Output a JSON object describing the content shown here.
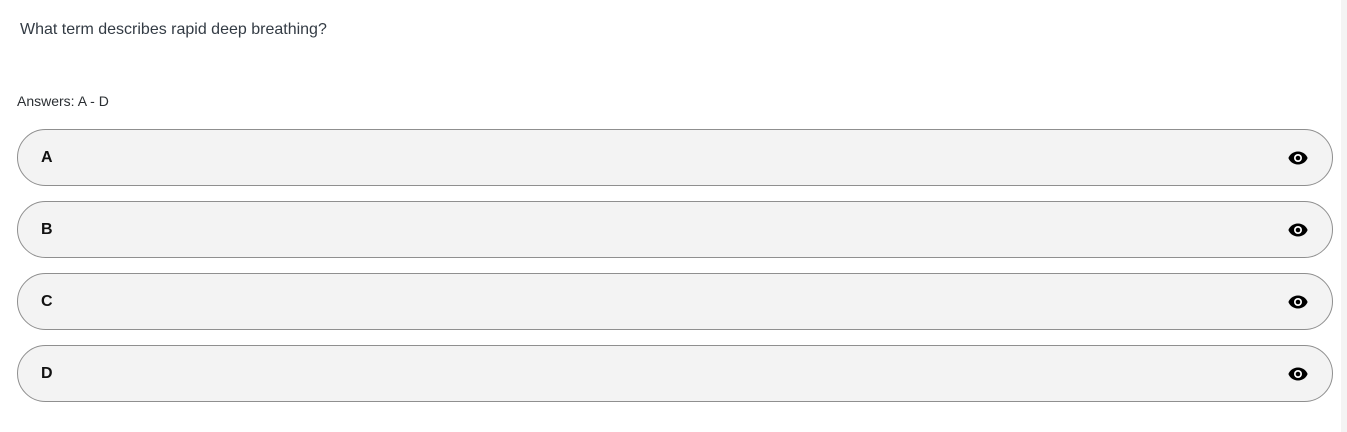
{
  "question": {
    "text": "What term describes rapid deep breathing?"
  },
  "answers_header": {
    "label": "Answers: A - D"
  },
  "answers": [
    {
      "letter": "A",
      "text": ""
    },
    {
      "letter": "B",
      "text": ""
    },
    {
      "letter": "C",
      "text": ""
    },
    {
      "letter": "D",
      "text": ""
    }
  ],
  "icons": {
    "reveal": "eye-icon"
  },
  "colors": {
    "option_background": "#f3f3f3",
    "option_border": "#8f8f8f",
    "text_primary": "#111111",
    "question_text": "#333b44"
  }
}
